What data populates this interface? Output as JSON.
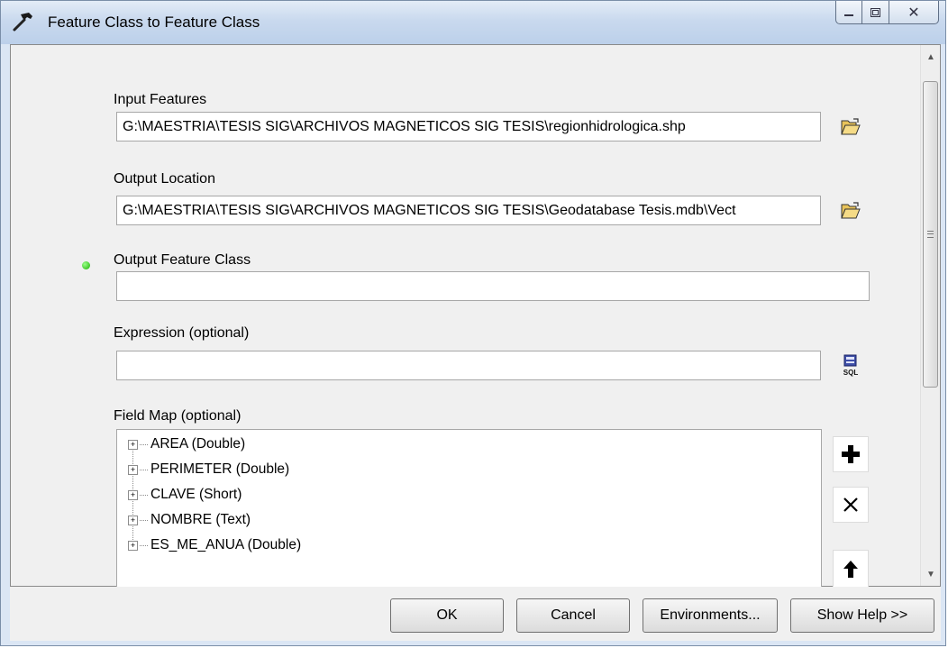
{
  "window": {
    "title": "Feature Class to Feature Class",
    "close_glyph": "✕"
  },
  "form": {
    "input_features": {
      "label": "Input Features",
      "value": "G:\\MAESTRIA\\TESIS SIG\\ARCHIVOS MAGNETICOS SIG TESIS\\regionhidrologica.shp"
    },
    "output_location": {
      "label": "Output Location",
      "value": "G:\\MAESTRIA\\TESIS SIG\\ARCHIVOS MAGNETICOS SIG TESIS\\Geodatabase Tesis.mdb\\Vect"
    },
    "output_feature_class": {
      "label": "Output Feature Class",
      "value": ""
    },
    "expression": {
      "label": "Expression (optional)",
      "value": "",
      "sql_button_text": "SQL"
    },
    "field_map": {
      "label": "Field Map (optional)",
      "items": [
        "AREA (Double)",
        "PERIMETER (Double)",
        "CLAVE (Short)",
        "NOMBRE (Text)",
        "ES_ME_ANUA (Double)"
      ],
      "add_glyph": "+",
      "delete_glyph": "✕",
      "up_glyph": "🢁"
    }
  },
  "buttons": {
    "ok": "OK",
    "cancel": "Cancel",
    "environments": "Environments...",
    "show_help": "Show Help >>"
  },
  "scrollbar": {
    "up_glyph": "▲",
    "down_glyph": "▼"
  },
  "icons": {
    "title": "hammer-icon",
    "browse": "folder-open-icon",
    "sql": "sql-icon",
    "required": "green-dot-icon"
  },
  "colors": {
    "title_gradient_top": "#e3ecf7",
    "title_gradient_bottom": "#bcd0ea",
    "client_bg": "#f0f0f0",
    "required_dot": "#18b000"
  }
}
